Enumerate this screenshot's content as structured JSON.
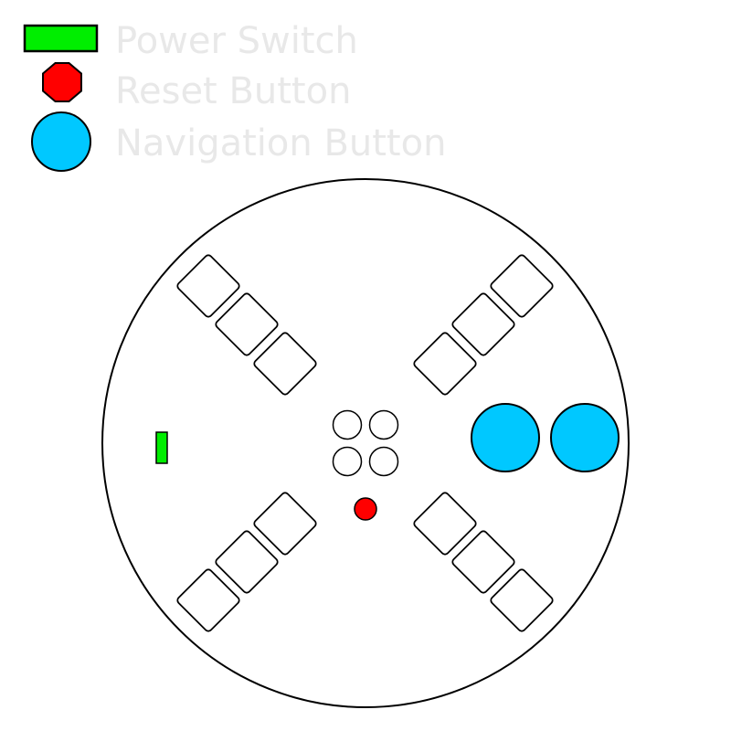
{
  "legend": {
    "items": [
      {
        "key": "power",
        "label": "Power Switch",
        "fill": "#00ee00"
      },
      {
        "key": "reset",
        "label": "Reset Button",
        "fill": "#ff0000"
      },
      {
        "key": "nav",
        "label": "Navigation Button",
        "fill": "#00c8ff"
      }
    ],
    "text_color": "#e8e8e8"
  },
  "device": {
    "body_fill": "#ffffff",
    "outline": "#000000",
    "key_fill": "#ffffff",
    "center_circle_fill": "#ffffff"
  }
}
